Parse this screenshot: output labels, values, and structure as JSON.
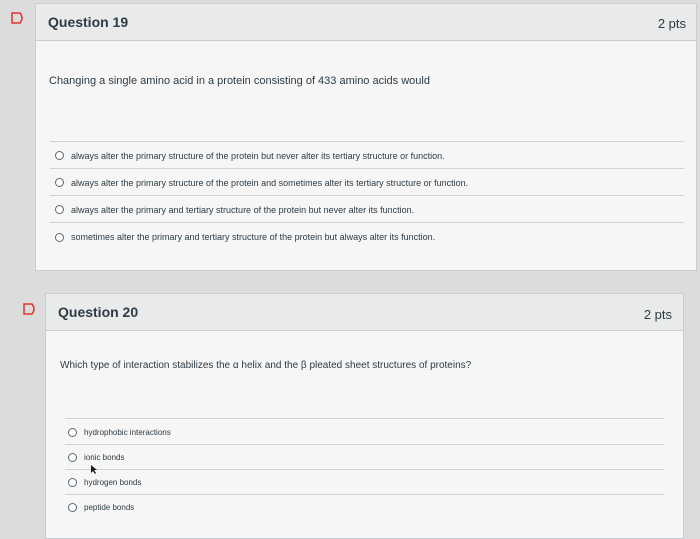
{
  "questions": [
    {
      "title": "Question 19",
      "points": "2 pts",
      "text": "Changing a single amino acid in a protein consisting of 433 amino acids would",
      "answers": [
        "always alter the primary structure of the protein but never alter its tertiary structure or function.",
        "always alter the primary structure of the protein and sometimes alter its tertiary structure or function.",
        "always alter the primary and tertiary structure of the protein but never alter its function.",
        "sometimes alter the primary and tertiary structure of the protein but always alter its function."
      ]
    },
    {
      "title": "Question 20",
      "points": "2 pts",
      "text": "Which type of interaction stabilizes the α helix and the β pleated sheet structures of proteins?",
      "answers": [
        "hydrophobic interactions",
        "ionic bonds",
        "hydrogen bonds",
        "peptide bonds"
      ]
    }
  ],
  "icons": {
    "flag": "flag-icon",
    "cursor": "mouse-cursor-icon"
  },
  "colors": {
    "flag": "#e3342f",
    "card_bg": "#f6f6f6",
    "header_bg": "#e9eaea"
  }
}
